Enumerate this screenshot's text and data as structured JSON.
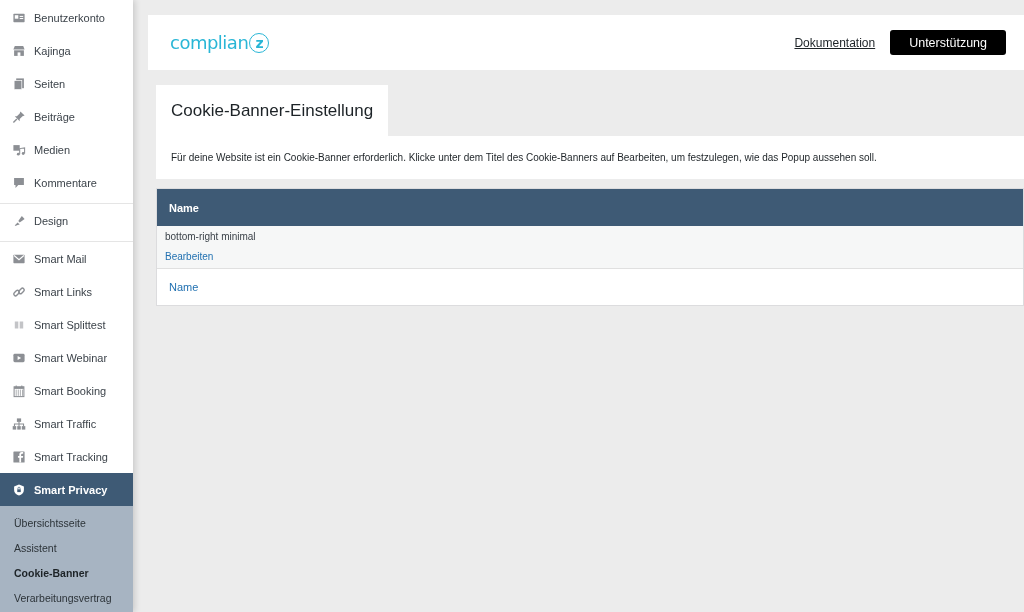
{
  "sidebar": {
    "groups": [
      [
        {
          "label": "Benutzerkonto",
          "selected": false
        },
        {
          "label": "Kajinga",
          "selected": false
        },
        {
          "label": "Seiten",
          "selected": false
        },
        {
          "label": "Beiträge",
          "selected": false
        },
        {
          "label": "Medien",
          "selected": false
        },
        {
          "label": "Kommentare",
          "selected": false
        }
      ],
      [
        {
          "label": "Design",
          "selected": false
        }
      ],
      [
        {
          "label": "Smart Mail",
          "selected": false
        },
        {
          "label": "Smart Links",
          "selected": false
        },
        {
          "label": "Smart Splittest",
          "selected": false
        },
        {
          "label": "Smart Webinar",
          "selected": false
        },
        {
          "label": "Smart Booking",
          "selected": false
        },
        {
          "label": "Smart Traffic",
          "selected": false
        },
        {
          "label": "Smart Tracking",
          "selected": false
        },
        {
          "label": "Smart Privacy",
          "selected": true,
          "children": [
            {
              "label": "Übersichtsseite",
              "selected": false
            },
            {
              "label": "Assistent",
              "selected": false
            },
            {
              "label": "Cookie-Banner",
              "selected": true
            },
            {
              "label": "Verarbeitungsvertrag",
              "selected": false
            }
          ]
        }
      ]
    ]
  },
  "header": {
    "logo": {
      "text": "complian",
      "mark": "z"
    },
    "link": "Dokumentation",
    "button": "Unterstützung"
  },
  "page": {
    "tab": "Cookie-Banner-Einstellung",
    "description": "Für deine Website ist ein Cookie-Banner erforderlich. Klicke unter dem Titel des Cookie-Banners auf Bearbeiten, um festzulegen, wie das Popup aussehen soll.",
    "table": {
      "columns": [
        "Name"
      ],
      "rows": [
        {
          "name": "bottom-right minimal",
          "action": "Bearbeiten"
        }
      ],
      "footer": "Name"
    }
  }
}
